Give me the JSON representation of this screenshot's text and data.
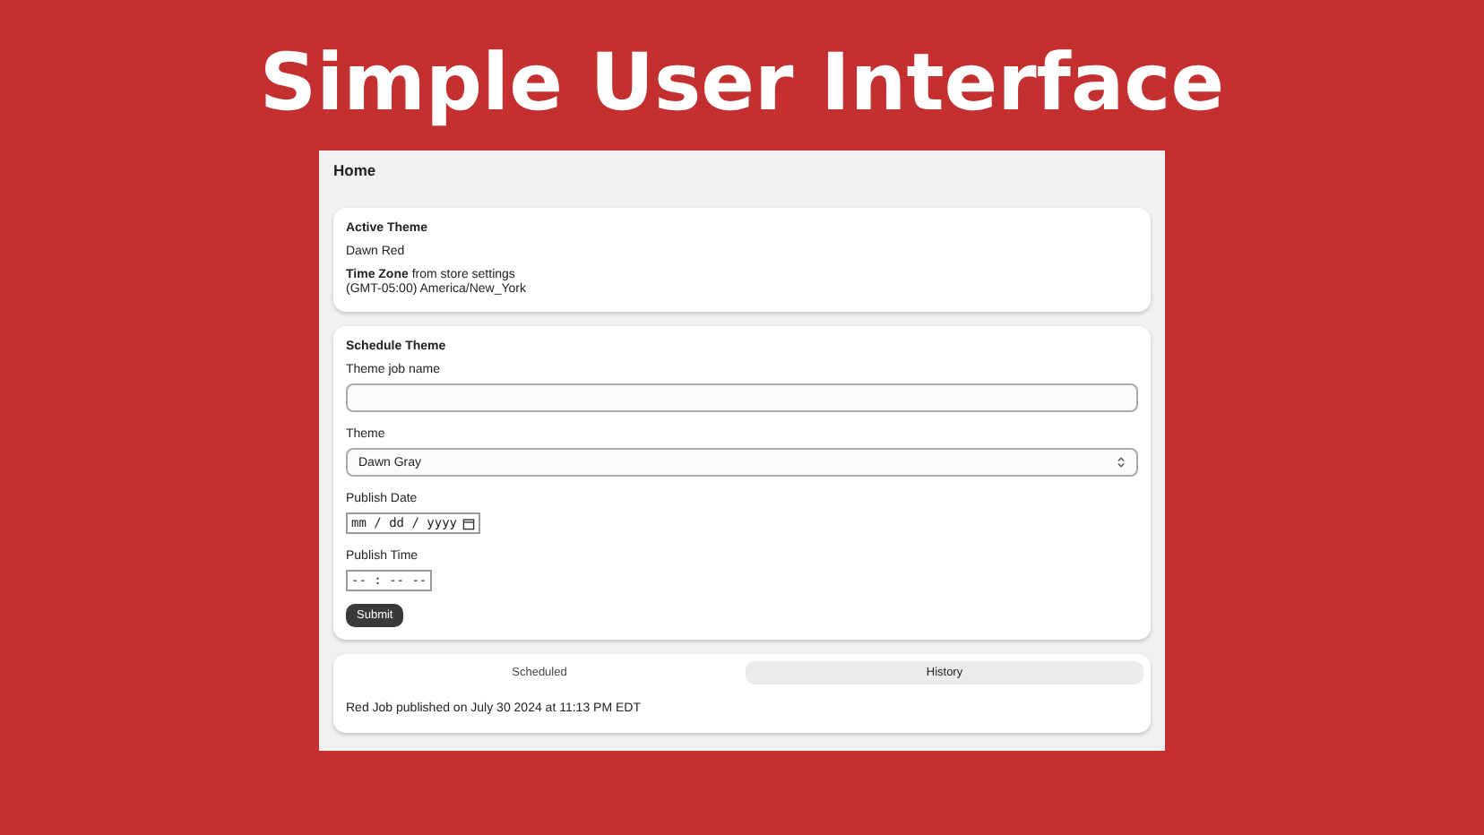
{
  "banner": {
    "title": "Simple User Interface"
  },
  "page": {
    "title": "Home"
  },
  "active_theme": {
    "heading": "Active Theme",
    "value": "Dawn Red",
    "timezone_label": "Time Zone",
    "timezone_note": " from store settings",
    "timezone": "(GMT-05:00) America/New_York"
  },
  "schedule": {
    "heading": "Schedule Theme",
    "fields": [
      {
        "kind": "text",
        "label": "Theme job name"
      },
      {
        "kind": "select",
        "label": "Theme",
        "value": "Dawn Gray"
      },
      {
        "kind": "date",
        "label": "Publish Date",
        "placeholder": "mm / dd / yyyy"
      },
      {
        "kind": "time",
        "label": "Publish Time",
        "placeholder": "-- : -- --"
      }
    ],
    "submit": "Submit"
  },
  "jobs": {
    "tabs": [
      {
        "label": "Scheduled",
        "selected": false
      },
      {
        "label": "History",
        "selected": true
      }
    ],
    "entries": [
      "Red Job published on July 30 2024 at 11:13 PM EDT"
    ]
  }
}
